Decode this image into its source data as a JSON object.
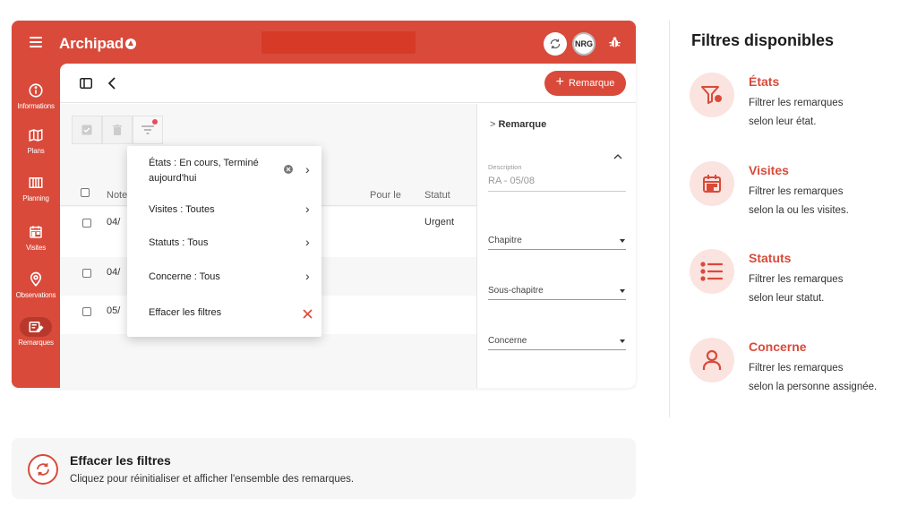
{
  "app": {
    "brand": "Archipad",
    "avatar_initials": "NRG",
    "accent_color": "#d94a3a"
  },
  "sidebar": {
    "items": [
      {
        "label": "Informations",
        "icon": "info-icon"
      },
      {
        "label": "Plans",
        "icon": "map-icon"
      },
      {
        "label": "Planning",
        "icon": "planning-icon"
      },
      {
        "label": "Visites",
        "icon": "calendar-icon"
      },
      {
        "label": "Observations",
        "icon": "location-pin-icon"
      },
      {
        "label": "Remarques",
        "icon": "edit-note-icon",
        "active": true
      }
    ]
  },
  "header": {
    "add_button_label": "Remarque"
  },
  "table": {
    "columns": [
      "Note",
      "Pour le",
      "Statut"
    ],
    "rows": [
      {
        "date": "04/",
        "statut": "Urgent"
      },
      {
        "date": "04/",
        "statut": ""
      },
      {
        "date": "05/",
        "statut": ""
      }
    ]
  },
  "filter_menu": {
    "items": [
      {
        "label": "États : En cours, Terminé aujourd'hui",
        "has_clear": true
      },
      {
        "label": "Visites : Toutes"
      },
      {
        "label": "Statuts : Tous"
      },
      {
        "label": "Concerne : Tous"
      }
    ],
    "clear_label": "Effacer les filtres"
  },
  "detail": {
    "breadcrumb": "Remarque",
    "description_label": "Description",
    "description_value": "RA - 05/08",
    "fields": [
      "Chapitre",
      "Sous-chapitre",
      "Concerne"
    ]
  },
  "panel": {
    "title": "Filtres disponibles",
    "features": [
      {
        "title": "États",
        "desc_line1": "Filtrer les remarques",
        "desc_line2": "selon leur état.",
        "icon": "filter-icon"
      },
      {
        "title": "Visites",
        "desc_line1": "Filtrer les remarques",
        "desc_line2": "selon la ou les visites.",
        "icon": "calendar-icon"
      },
      {
        "title": "Statuts",
        "desc_line1": "Filtrer les remarques",
        "desc_line2": "selon leur statut.",
        "icon": "list-icon"
      },
      {
        "title": "Concerne",
        "desc_line1": "Filtrer les remarques",
        "desc_line2": "selon la personne assignée.",
        "icon": "person-icon"
      }
    ]
  },
  "info_card": {
    "title": "Effacer les filtres",
    "description": "Cliquez pour réinitialiser et afficher l'ensemble des remarques."
  }
}
